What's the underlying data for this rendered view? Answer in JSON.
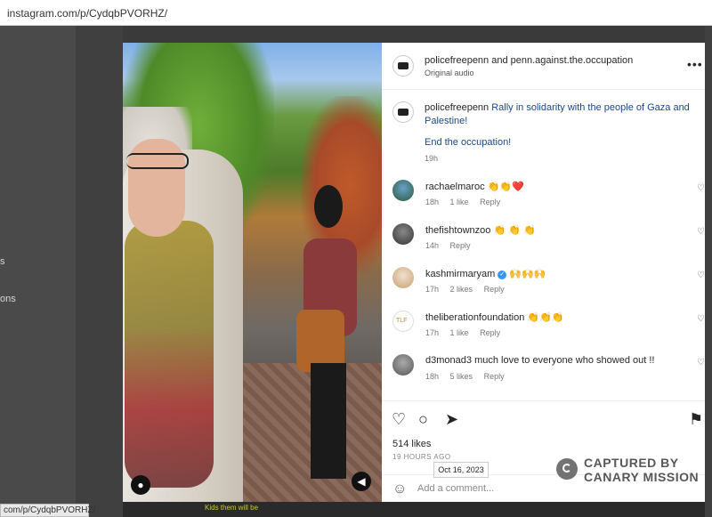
{
  "browser": {
    "url": "instagram.com/p/CydqbPVORHZ/",
    "status_url": "com/p/CydqbPVORHZ/"
  },
  "background": {
    "left_texts": [
      "s",
      "ons"
    ],
    "bottom_caption": "Kids them will be"
  },
  "post": {
    "header": {
      "user": "policefreepenn",
      "connector": "and",
      "coauthor": "penn.against.the.occupation",
      "audio": "Original audio",
      "more_icon": "more-icon"
    },
    "caption": {
      "user": "policefreepenn",
      "text": "Rally in solidarity with the people of Gaza and Palestine!",
      "line2": "End the occupation!",
      "time": "19h"
    },
    "comments": [
      {
        "user": "rachaelmaroc",
        "text": "👏👏❤️",
        "time": "18h",
        "likes": "1 like",
        "reply": "Reply",
        "verified": false
      },
      {
        "user": "thefishtownzoo",
        "text": "👏 👏 👏",
        "time": "14h",
        "likes": "",
        "reply": "Reply",
        "verified": false
      },
      {
        "user": "kashmirmaryam",
        "text": "🙌🙌🙌",
        "time": "17h",
        "likes": "2 likes",
        "reply": "Reply",
        "verified": true
      },
      {
        "user": "theliberationfoundation",
        "text": "👏👏👏",
        "time": "17h",
        "likes": "1 like",
        "reply": "Reply",
        "verified": false
      },
      {
        "user": "d3monad3",
        "text": "much love to everyone who showed out !!",
        "time": "18h",
        "likes": "5 likes",
        "reply": "Reply",
        "verified": false
      }
    ],
    "likes": "514 likes",
    "ago": "19 HOURS AGO",
    "date_tooltip": "Oct 16, 2023",
    "add_comment_placeholder": "Add a comment..."
  },
  "watermark": {
    "line1": "CAPTURED BY",
    "line2": "CANARY MISSION"
  }
}
